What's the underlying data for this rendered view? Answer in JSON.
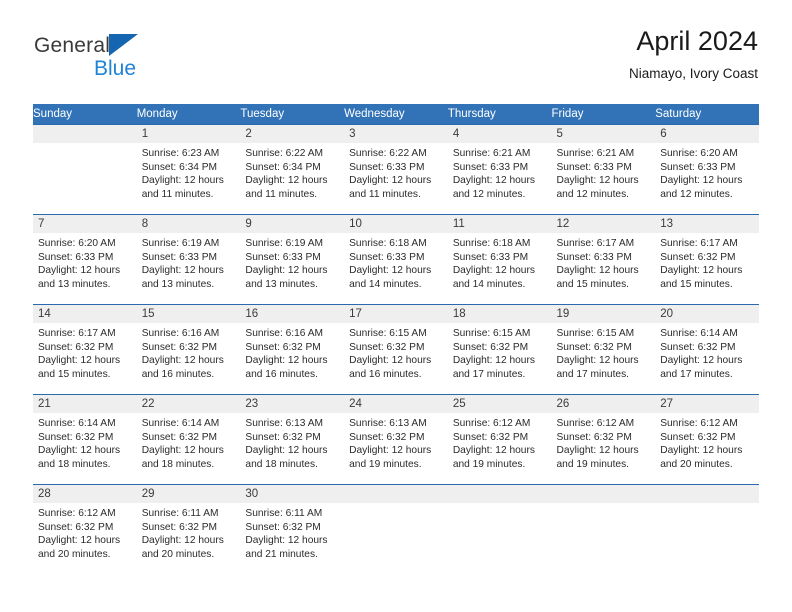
{
  "brand": {
    "word_one": "General",
    "word_two": "Blue",
    "triangle_icon": "triangle-logo-icon",
    "primary_color": "#1565b0",
    "secondary_color": "#1f83d6"
  },
  "header": {
    "title": "April 2024",
    "subtitle": "Niamayo, Ivory Coast"
  },
  "calendar": {
    "header_bg": "#3273b7",
    "row_border": "#2a69ad",
    "daynum_bg": "#efefef",
    "weekday_headers": [
      "Sunday",
      "Monday",
      "Tuesday",
      "Wednesday",
      "Thursday",
      "Friday",
      "Saturday"
    ],
    "weeks": [
      [
        {
          "day": "",
          "lines": []
        },
        {
          "day": "1",
          "lines": [
            "Sunrise: 6:23 AM",
            "Sunset: 6:34 PM",
            "Daylight: 12 hours",
            "and 11 minutes."
          ]
        },
        {
          "day": "2",
          "lines": [
            "Sunrise: 6:22 AM",
            "Sunset: 6:34 PM",
            "Daylight: 12 hours",
            "and 11 minutes."
          ]
        },
        {
          "day": "3",
          "lines": [
            "Sunrise: 6:22 AM",
            "Sunset: 6:33 PM",
            "Daylight: 12 hours",
            "and 11 minutes."
          ]
        },
        {
          "day": "4",
          "lines": [
            "Sunrise: 6:21 AM",
            "Sunset: 6:33 PM",
            "Daylight: 12 hours",
            "and 12 minutes."
          ]
        },
        {
          "day": "5",
          "lines": [
            "Sunrise: 6:21 AM",
            "Sunset: 6:33 PM",
            "Daylight: 12 hours",
            "and 12 minutes."
          ]
        },
        {
          "day": "6",
          "lines": [
            "Sunrise: 6:20 AM",
            "Sunset: 6:33 PM",
            "Daylight: 12 hours",
            "and 12 minutes."
          ]
        }
      ],
      [
        {
          "day": "7",
          "lines": [
            "Sunrise: 6:20 AM",
            "Sunset: 6:33 PM",
            "Daylight: 12 hours",
            "and 13 minutes."
          ]
        },
        {
          "day": "8",
          "lines": [
            "Sunrise: 6:19 AM",
            "Sunset: 6:33 PM",
            "Daylight: 12 hours",
            "and 13 minutes."
          ]
        },
        {
          "day": "9",
          "lines": [
            "Sunrise: 6:19 AM",
            "Sunset: 6:33 PM",
            "Daylight: 12 hours",
            "and 13 minutes."
          ]
        },
        {
          "day": "10",
          "lines": [
            "Sunrise: 6:18 AM",
            "Sunset: 6:33 PM",
            "Daylight: 12 hours",
            "and 14 minutes."
          ]
        },
        {
          "day": "11",
          "lines": [
            "Sunrise: 6:18 AM",
            "Sunset: 6:33 PM",
            "Daylight: 12 hours",
            "and 14 minutes."
          ]
        },
        {
          "day": "12",
          "lines": [
            "Sunrise: 6:17 AM",
            "Sunset: 6:33 PM",
            "Daylight: 12 hours",
            "and 15 minutes."
          ]
        },
        {
          "day": "13",
          "lines": [
            "Sunrise: 6:17 AM",
            "Sunset: 6:32 PM",
            "Daylight: 12 hours",
            "and 15 minutes."
          ]
        }
      ],
      [
        {
          "day": "14",
          "lines": [
            "Sunrise: 6:17 AM",
            "Sunset: 6:32 PM",
            "Daylight: 12 hours",
            "and 15 minutes."
          ]
        },
        {
          "day": "15",
          "lines": [
            "Sunrise: 6:16 AM",
            "Sunset: 6:32 PM",
            "Daylight: 12 hours",
            "and 16 minutes."
          ]
        },
        {
          "day": "16",
          "lines": [
            "Sunrise: 6:16 AM",
            "Sunset: 6:32 PM",
            "Daylight: 12 hours",
            "and 16 minutes."
          ]
        },
        {
          "day": "17",
          "lines": [
            "Sunrise: 6:15 AM",
            "Sunset: 6:32 PM",
            "Daylight: 12 hours",
            "and 16 minutes."
          ]
        },
        {
          "day": "18",
          "lines": [
            "Sunrise: 6:15 AM",
            "Sunset: 6:32 PM",
            "Daylight: 12 hours",
            "and 17 minutes."
          ]
        },
        {
          "day": "19",
          "lines": [
            "Sunrise: 6:15 AM",
            "Sunset: 6:32 PM",
            "Daylight: 12 hours",
            "and 17 minutes."
          ]
        },
        {
          "day": "20",
          "lines": [
            "Sunrise: 6:14 AM",
            "Sunset: 6:32 PM",
            "Daylight: 12 hours",
            "and 17 minutes."
          ]
        }
      ],
      [
        {
          "day": "21",
          "lines": [
            "Sunrise: 6:14 AM",
            "Sunset: 6:32 PM",
            "Daylight: 12 hours",
            "and 18 minutes."
          ]
        },
        {
          "day": "22",
          "lines": [
            "Sunrise: 6:14 AM",
            "Sunset: 6:32 PM",
            "Daylight: 12 hours",
            "and 18 minutes."
          ]
        },
        {
          "day": "23",
          "lines": [
            "Sunrise: 6:13 AM",
            "Sunset: 6:32 PM",
            "Daylight: 12 hours",
            "and 18 minutes."
          ]
        },
        {
          "day": "24",
          "lines": [
            "Sunrise: 6:13 AM",
            "Sunset: 6:32 PM",
            "Daylight: 12 hours",
            "and 19 minutes."
          ]
        },
        {
          "day": "25",
          "lines": [
            "Sunrise: 6:12 AM",
            "Sunset: 6:32 PM",
            "Daylight: 12 hours",
            "and 19 minutes."
          ]
        },
        {
          "day": "26",
          "lines": [
            "Sunrise: 6:12 AM",
            "Sunset: 6:32 PM",
            "Daylight: 12 hours",
            "and 19 minutes."
          ]
        },
        {
          "day": "27",
          "lines": [
            "Sunrise: 6:12 AM",
            "Sunset: 6:32 PM",
            "Daylight: 12 hours",
            "and 20 minutes."
          ]
        }
      ],
      [
        {
          "day": "28",
          "lines": [
            "Sunrise: 6:12 AM",
            "Sunset: 6:32 PM",
            "Daylight: 12 hours",
            "and 20 minutes."
          ]
        },
        {
          "day": "29",
          "lines": [
            "Sunrise: 6:11 AM",
            "Sunset: 6:32 PM",
            "Daylight: 12 hours",
            "and 20 minutes."
          ]
        },
        {
          "day": "30",
          "lines": [
            "Sunrise: 6:11 AM",
            "Sunset: 6:32 PM",
            "Daylight: 12 hours",
            "and 21 minutes."
          ]
        },
        {
          "day": "",
          "lines": []
        },
        {
          "day": "",
          "lines": []
        },
        {
          "day": "",
          "lines": []
        },
        {
          "day": "",
          "lines": []
        }
      ]
    ]
  }
}
